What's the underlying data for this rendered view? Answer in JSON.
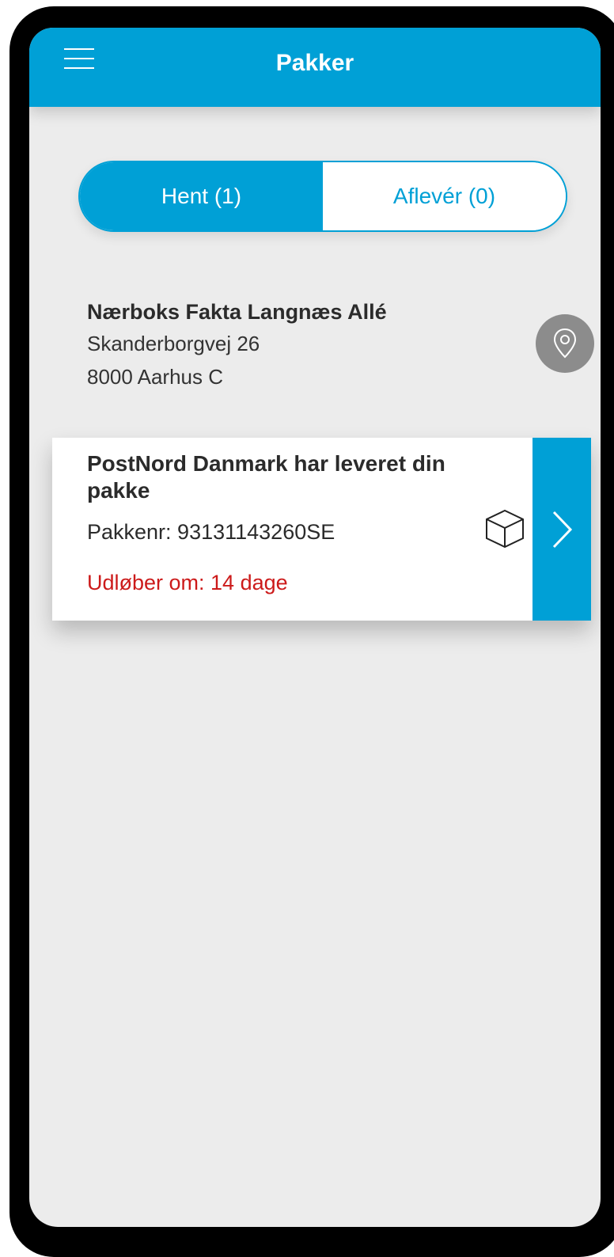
{
  "header": {
    "title": "Pakker",
    "menu_icon": "hamburger-menu-icon"
  },
  "tabs": [
    {
      "label": "Hent (1)",
      "active": true
    },
    {
      "label": "Aflevér (0)",
      "active": false
    }
  ],
  "location": {
    "name": "Nærboks Fakta Langnæs Allé",
    "street": "Skanderborgvej 26",
    "city": "8000 Aarhus C",
    "icon": "map-pin-icon"
  },
  "parcel": {
    "title": "PostNord Danmark har leveret din pakke",
    "number": "Pakkenr: 93131143260SE",
    "expiry": "Udløber om: 14 dage",
    "icon": "package-box-icon",
    "action_icon": "chevron-right-icon"
  },
  "colors": {
    "accent": "#00a0d6",
    "background": "#ececec",
    "expiry": "#cc1a1a",
    "pin_background": "#8c8c8c"
  }
}
